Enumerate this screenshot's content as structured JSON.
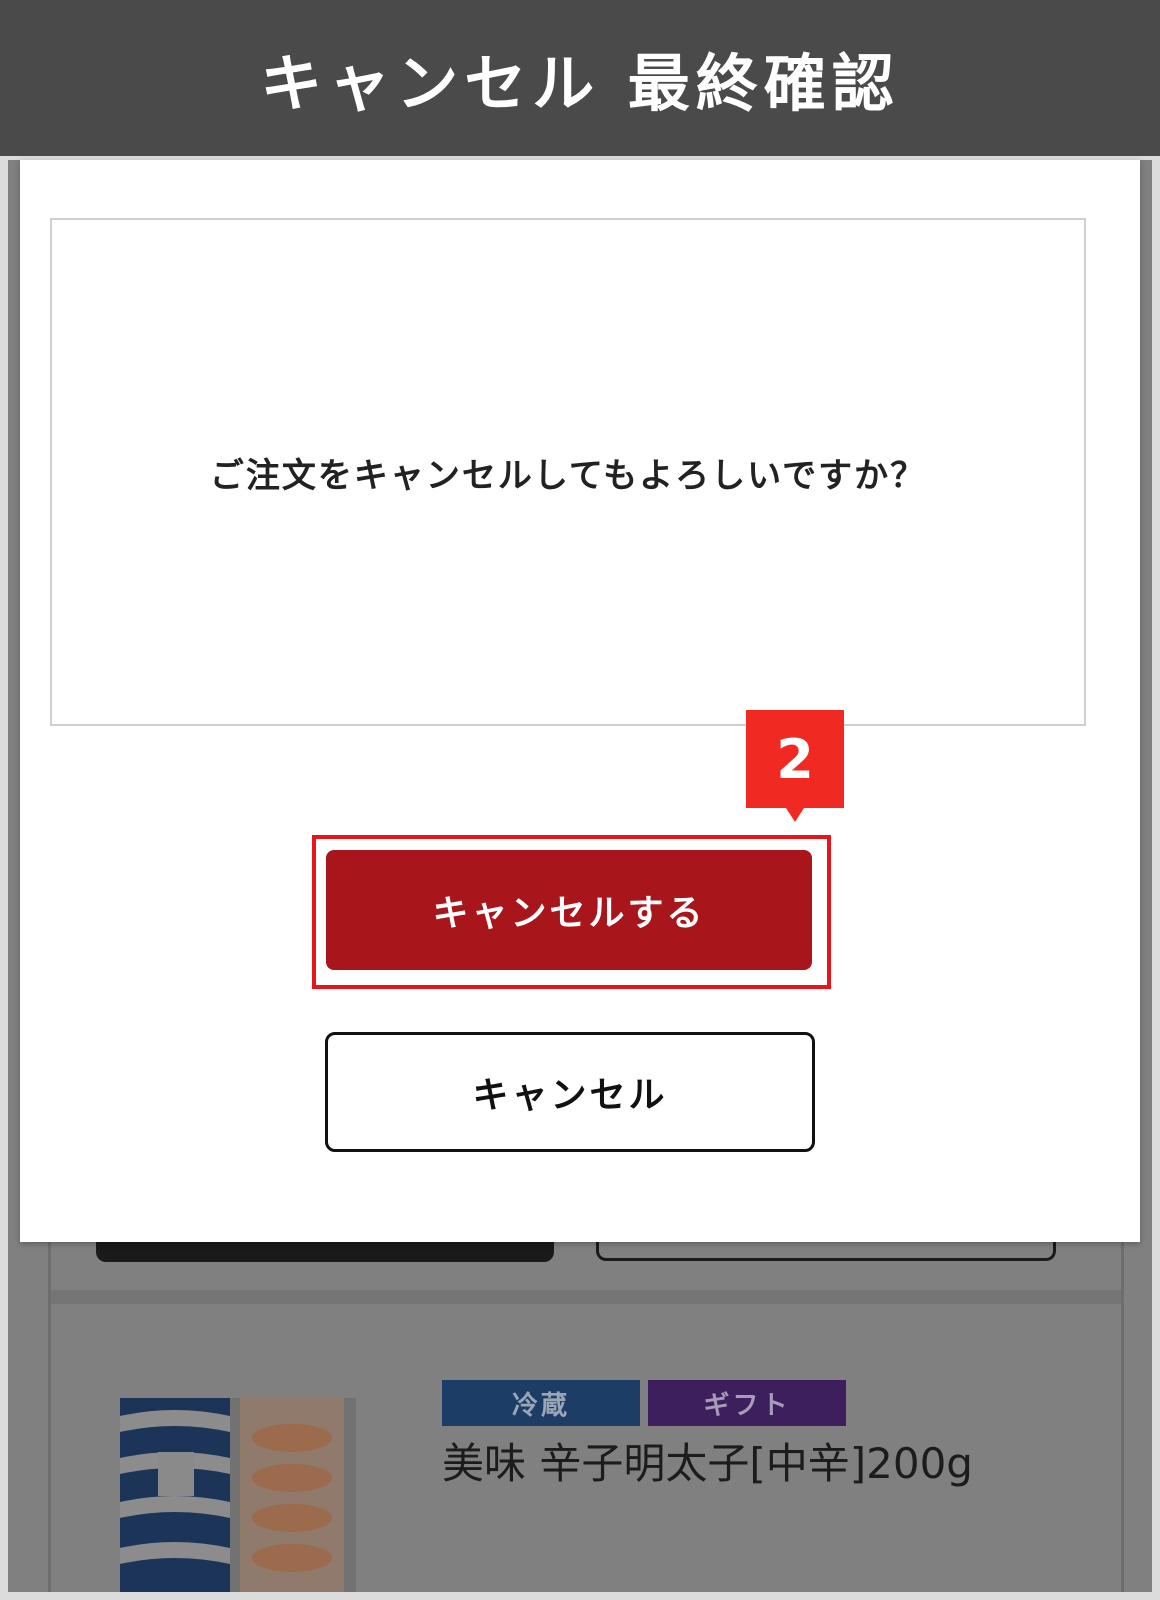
{
  "header": {
    "title": "キャンセル 最終確認"
  },
  "dialog": {
    "message": "ご注文をキャンセルしてもよろしいですか？",
    "confirm_label": "キャンセルする",
    "cancel_label": "キャンセル",
    "step_badge": "2"
  },
  "background": {
    "tags": [
      "冷蔵",
      "ギフト"
    ],
    "product_name": "美味 辛子明太子[中辛]200g"
  },
  "colors": {
    "header_bg": "#4a4a4a",
    "confirm_button": "#a8161b",
    "highlight": "#e8141c",
    "badge": "#f02a22"
  }
}
